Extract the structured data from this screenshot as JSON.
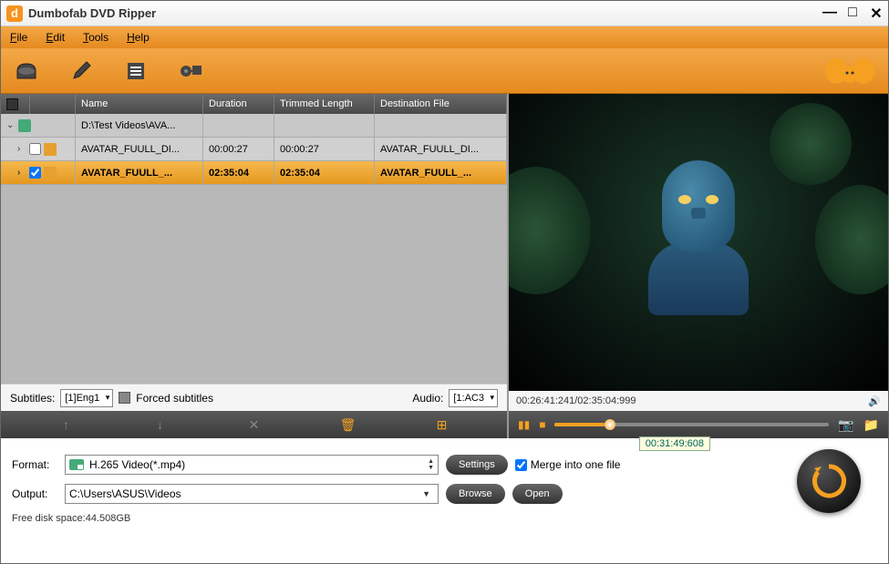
{
  "title": "Dumbofab DVD Ripper",
  "menus": {
    "file": "File",
    "edit": "Edit",
    "tools": "Tools",
    "help": "Help"
  },
  "columns": {
    "name": "Name",
    "duration": "Duration",
    "trimmed": "Trimmed Length",
    "dest": "Destination File"
  },
  "rows": {
    "group": {
      "name": "D:\\Test Videos\\AVA..."
    },
    "r1": {
      "name": "AVATAR_FUULL_DI...",
      "duration": "00:00:27",
      "trimmed": "00:00:27",
      "dest": "AVATAR_FUULL_DI..."
    },
    "r2": {
      "name": "AVATAR_FUULL_...",
      "duration": "02:35:04",
      "trimmed": "02:35:04",
      "dest": "AVATAR_FUULL_..."
    }
  },
  "subaudio": {
    "subtitles_label": "Subtitles:",
    "subtitles_value": "[1]Eng1",
    "forced_label": "Forced subtitles",
    "audio_label": "Audio:",
    "audio_value": "[1:AC3"
  },
  "preview": {
    "time_display": "00:26:41:241/02:35:04:999",
    "tooltip_time": "00:31:49:608"
  },
  "format": {
    "label": "Format:",
    "value": "H.265 Video(*.mp4)",
    "settings": "Settings",
    "merge": "Merge into one file"
  },
  "output": {
    "label": "Output:",
    "value": "C:\\Users\\ASUS\\Videos",
    "browse": "Browse",
    "open": "Open"
  },
  "disk_space": "Free disk space:44.508GB"
}
